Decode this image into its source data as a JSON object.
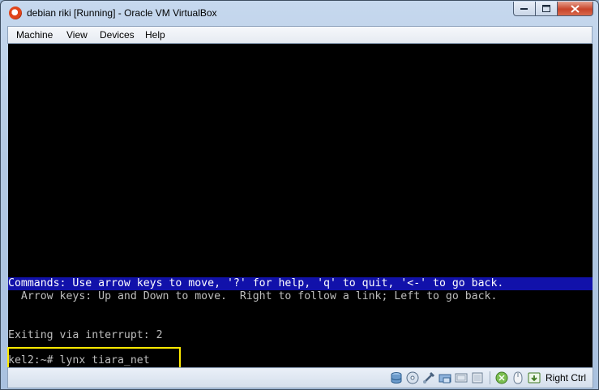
{
  "window": {
    "title": "debian riki [Running] - Oracle VM VirtualBox"
  },
  "menu": [
    "Machine",
    "View",
    "Devices",
    "Help"
  ],
  "terminal": {
    "commands_line": "Commands: Use arrow keys to move, '?' for help, 'q' to quit, '<-' to go back.",
    "arrow_line": "  Arrow keys: Up and Down to move.  Right to follow a link; Left to go back.",
    "exit_line": "Exiting via interrupt: 2",
    "prompt_line": "kel2:~# lynx tiara_net",
    "colors": {
      "background": "#000000",
      "text": "#bdbdbd",
      "command_bar": "#1111aa",
      "highlight_box": "#ffea00"
    }
  },
  "statusbar": {
    "icons": [
      "hard-disk-icon",
      "optical-drive-icon",
      "usb-icon",
      "shared-folders-icon",
      "network-icon",
      "display-icon",
      "capture-icon",
      "mouse-integration-icon",
      "host-key-icon"
    ],
    "host_key_label": "Right Ctrl"
  }
}
